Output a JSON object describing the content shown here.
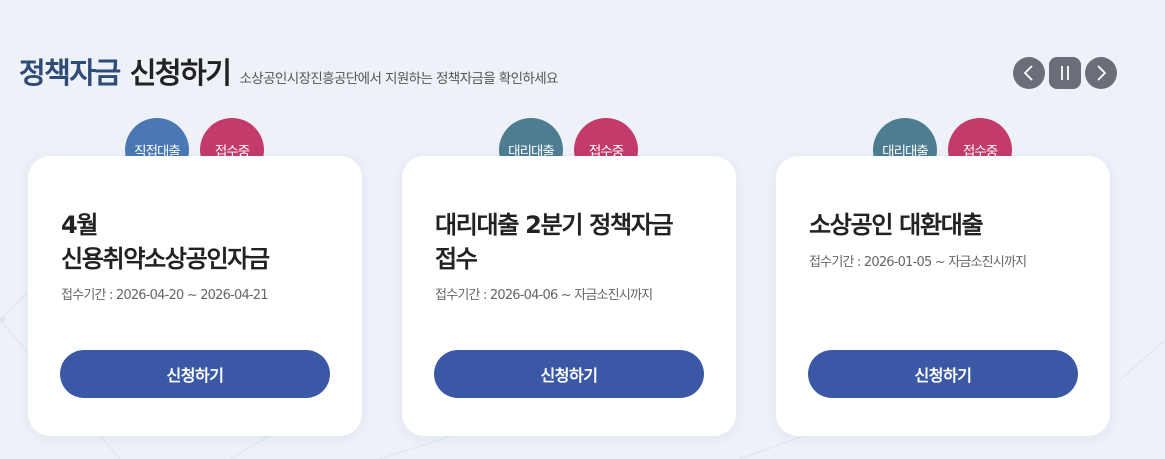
{
  "header": {
    "title_accent": "정책자금",
    "title_main": "신청하기",
    "subtitle": "소상공인시장진흥공단에서 지원하는 정책자금을 확인하세요"
  },
  "controls": {
    "prev_icon": "chevron-left-icon",
    "pause_icon": "pause-icon",
    "next_icon": "chevron-right-icon",
    "button_color": "#6b6e78"
  },
  "colors": {
    "accent": "#2d4d78",
    "button": "#3a58a6",
    "badge_direct": "#4a78b4",
    "badge_agency": "#4e7d92",
    "badge_open": "#c33b6b"
  },
  "cards": [
    {
      "type_badge": "직접대출",
      "status_badge": "접수중",
      "title_line1": "4월",
      "title_line2": "신용취약소상공인자금",
      "period": "접수기간 : 2026-04-20 ~ 2026-04-21",
      "button": "신청하기"
    },
    {
      "type_badge": "대리대출",
      "status_badge": "접수중",
      "title_line1": "대리대출 2분기 정책자금",
      "title_line2": "접수",
      "period": "접수기간 : 2026-04-06 ~ 자금소진시까지",
      "button": "신청하기"
    },
    {
      "type_badge": "대리대출",
      "status_badge": "접수중",
      "title_line1": "소상공인 대환대출",
      "title_line2": "",
      "period": "접수기간 : 2026-01-05 ~ 자금소진시까지",
      "button": "신청하기"
    }
  ]
}
